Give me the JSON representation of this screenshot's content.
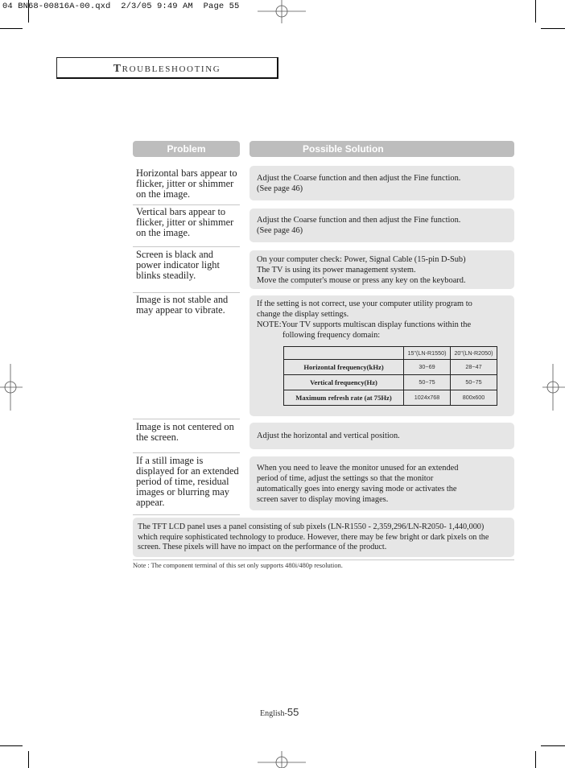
{
  "slug": {
    "text": "04 BN68-00816A-00.qxd  2/3/05 9:49 AM  Page 55"
  },
  "section": {
    "title_initial": "T",
    "title_rest": "ROUBLESHOOTING"
  },
  "table": {
    "headers": {
      "problem": "Problem",
      "solution": "Possible Solution"
    },
    "rows": [
      {
        "problem": "Horizontal bars appear to flicker, jitter or shimmer on the image.",
        "solution_lines": [
          "Adjust the Coarse function and then adjust the Fine function.",
          "(See page 46)"
        ]
      },
      {
        "problem": "Vertical bars appear to flicker, jitter or shimmer on the image.",
        "solution_lines": [
          "Adjust the Coarse function and then adjust the Fine function.",
          "(See page 46)"
        ]
      },
      {
        "problem": "Screen is black and power indicator light blinks steadily.",
        "solution_lines": [
          "On your computer check: Power, Signal Cable (15-pin D-Sub)",
          "The TV is using its power management system.",
          "Move the computer's mouse or press any key on the keyboard."
        ]
      },
      {
        "problem": "Image is not stable and may appear to vibrate.",
        "solution_lines": [
          "If the setting is not correct, use your computer utility program to change the display settings."
        ],
        "note_label": "NOTE:",
        "note_text_1": "Your TV supports multiscan display functions within the",
        "note_text_2": "following frequency domain:",
        "freq_table": {
          "columns": [
            "",
            "15\"(LN-R1550)",
            "20\"(LN-R2050)"
          ],
          "rows": [
            {
              "label": "Horizontal frequency(kHz)",
              "values": [
                "30~69",
                "28~47"
              ]
            },
            {
              "label": "Vertical frequency(Hz)",
              "values": [
                "50~75",
                "50~75"
              ]
            },
            {
              "label": "Maximum refresh rate (at 75Hz)",
              "values": [
                "1024x768",
                "800x600"
              ]
            }
          ]
        }
      },
      {
        "problem": "Image is not centered on the screen.",
        "solution_lines": [
          "Adjust the horizontal and vertical position."
        ]
      },
      {
        "problem": "If a still image is displayed for an extended period of time, residual images or blurring may appear.",
        "solution_lines": [
          "When you need to leave the monitor unused for an extended",
          "period of time, adjust the settings so that the monitor",
          "automatically goes into energy saving mode or activates the",
          "screen saver to display moving images."
        ]
      }
    ]
  },
  "panel_note": {
    "lines": [
      "The TFT LCD panel uses a panel consisting of sub pixels (LN-R1550 - 2,359,296/LN-R2050- 1,440,000)",
      "which require sophisticated technology to produce. However, there may be few bright or dark pixels on the",
      "screen. These pixels will have no impact on the performance of the product."
    ]
  },
  "footnote": "Note : The component terminal of this set only supports 480i/480p resolution.",
  "page_number": {
    "prefix": "English-",
    "number": "55"
  }
}
